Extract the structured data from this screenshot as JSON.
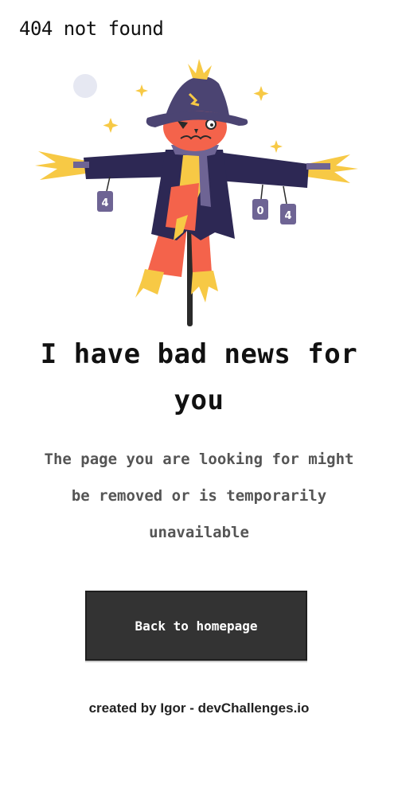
{
  "header": {
    "title": "404 not found"
  },
  "illustration": {
    "cans": [
      "4",
      "0",
      "4"
    ],
    "icon": "scarecrow-illustration",
    "colors": {
      "hat": "#4b4472",
      "face": "#f4634b",
      "shirt": "#2d2854",
      "straw": "#f7c945",
      "can": "#6e6494",
      "pole": "#2a2a2a",
      "moon": "#e6e8f2"
    }
  },
  "main": {
    "headline": "I have bad news for you",
    "description": "The page you are looking for might be removed or is temporarily unavailable",
    "back_button_label": "Back to homepage"
  },
  "footer": {
    "prefix": "created by ",
    "author": "Igor",
    "separator": " - ",
    "site": "devChallenges.io"
  }
}
